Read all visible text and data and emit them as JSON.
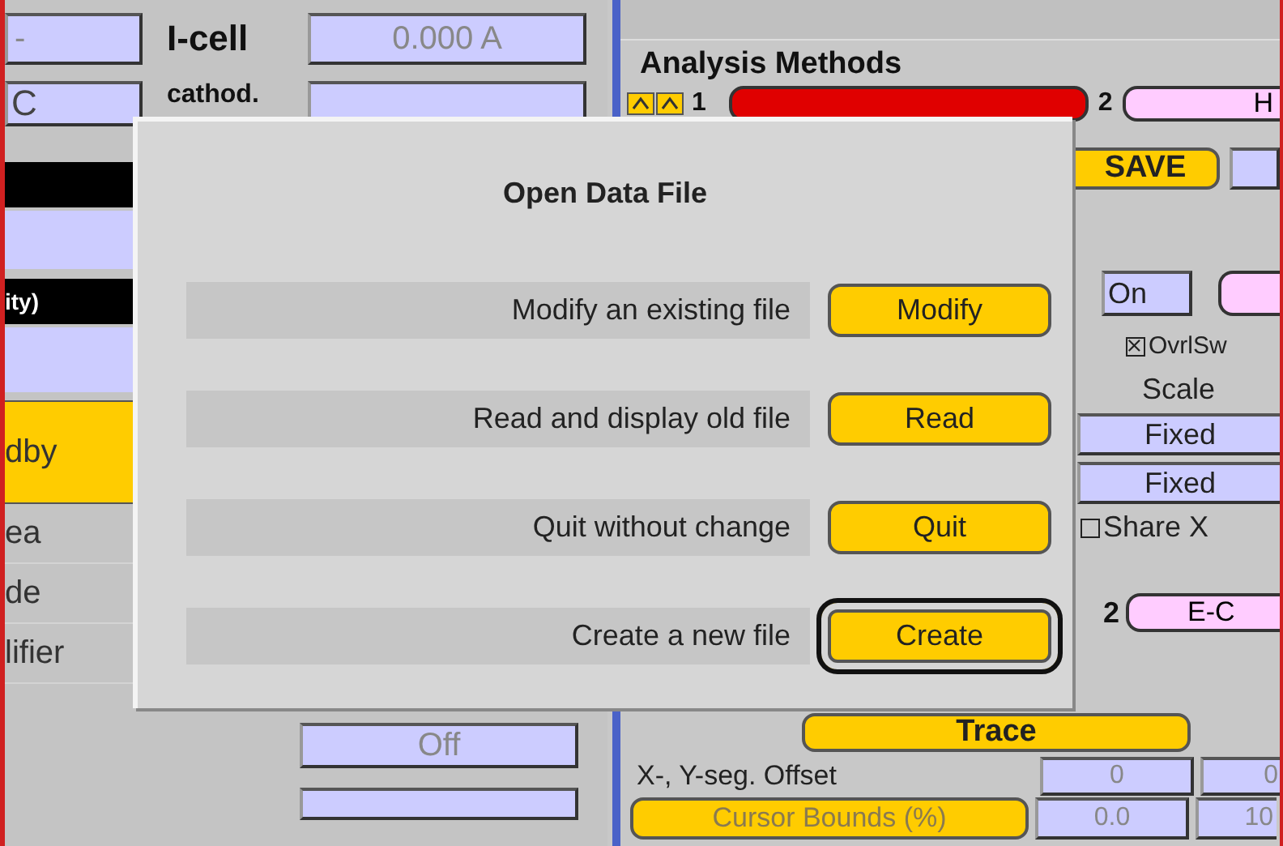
{
  "status_panel": {
    "current_field": "-",
    "current_label": "I-cell",
    "current_value": "0.000 A",
    "charge_field": "C",
    "charge_label": "cathod.",
    "mode_label": "ity)",
    "state_button": "dby",
    "labels": [
      "ea",
      "de",
      "lifier"
    ],
    "filter_value": "Off"
  },
  "analysis": {
    "title": "Analysis Methods",
    "method_1": "1",
    "method_2": "2",
    "method_2_button": "H",
    "save_button": "SAVE",
    "on_button": "On",
    "overlay": {
      "label": "OvrlSw",
      "checked": true
    },
    "scale_header": "Scale",
    "scales": [
      "Fixed",
      "Fixed"
    ],
    "share_x": {
      "label": "Share X",
      "checked": false
    },
    "trace_2_number": "2",
    "trace_2_button": "E-C",
    "trace_button": "Trace",
    "offset_label": "X-, Y-seg. Offset",
    "offset_values": [
      "0",
      "0"
    ],
    "cursor_button": "Cursor Bounds (%)",
    "cursor_values": [
      "0.0",
      "10"
    ]
  },
  "dialog": {
    "title": "Open Data File",
    "options": [
      {
        "label": "Modify an existing file",
        "button": "Modify",
        "selected": false
      },
      {
        "label": "Read and display old file",
        "button": "Read",
        "selected": false
      },
      {
        "label": "Quit without change",
        "button": "Quit",
        "selected": false
      },
      {
        "label": "Create a new file",
        "button": "Create",
        "selected": true
      }
    ]
  }
}
